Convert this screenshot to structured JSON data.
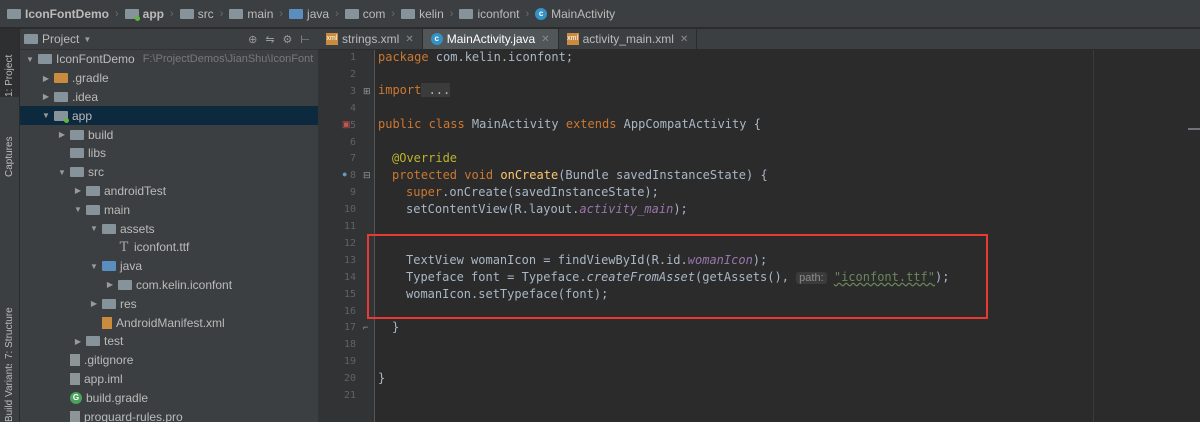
{
  "breadcrumb": [
    "IconFontDemo",
    "app",
    "src",
    "main",
    "java",
    "com",
    "kelin",
    "iconfont",
    "MainActivity"
  ],
  "left_tabs": {
    "project": "1: Project",
    "captures": "Captures",
    "structure": "7: Structure",
    "variants": "Build Variants"
  },
  "project_panel": {
    "title": "Project",
    "tree": [
      {
        "label": "IconFontDemo",
        "path": "F:\\ProjectDemos\\JianShu\\IconFont",
        "indent": 0,
        "arrow": "down",
        "icon": "folder"
      },
      {
        "label": ".gradle",
        "indent": 1,
        "arrow": "right",
        "icon": "folder-orange"
      },
      {
        "label": ".idea",
        "indent": 1,
        "arrow": "right",
        "icon": "folder"
      },
      {
        "label": "app",
        "indent": 1,
        "arrow": "down",
        "icon": "folder-app",
        "selected": true
      },
      {
        "label": "build",
        "indent": 2,
        "arrow": "right",
        "icon": "folder"
      },
      {
        "label": "libs",
        "indent": 2,
        "arrow": "",
        "icon": "folder"
      },
      {
        "label": "src",
        "indent": 2,
        "arrow": "down",
        "icon": "folder"
      },
      {
        "label": "androidTest",
        "indent": 3,
        "arrow": "right",
        "icon": "folder"
      },
      {
        "label": "main",
        "indent": 3,
        "arrow": "down",
        "icon": "folder"
      },
      {
        "label": "assets",
        "indent": 4,
        "arrow": "down",
        "icon": "folder"
      },
      {
        "label": "iconfont.ttf",
        "indent": 5,
        "arrow": "",
        "icon": "font-file"
      },
      {
        "label": "java",
        "indent": 4,
        "arrow": "down",
        "icon": "folder-blue"
      },
      {
        "label": "com.kelin.iconfont",
        "indent": 5,
        "arrow": "right",
        "icon": "folder"
      },
      {
        "label": "res",
        "indent": 4,
        "arrow": "right",
        "icon": "folder"
      },
      {
        "label": "AndroidManifest.xml",
        "indent": 4,
        "arrow": "",
        "icon": "xml-file"
      },
      {
        "label": "test",
        "indent": 3,
        "arrow": "right",
        "icon": "folder"
      },
      {
        "label": ".gitignore",
        "indent": 2,
        "arrow": "",
        "icon": "file"
      },
      {
        "label": "app.iml",
        "indent": 2,
        "arrow": "",
        "icon": "file"
      },
      {
        "label": "build.gradle",
        "indent": 2,
        "arrow": "",
        "icon": "gradle-file"
      },
      {
        "label": "proguard-rules.pro",
        "indent": 2,
        "arrow": "",
        "icon": "file"
      }
    ]
  },
  "tabs": [
    {
      "label": "strings.xml",
      "icon": "xml-file"
    },
    {
      "label": "MainActivity.java",
      "icon": "class",
      "active": true
    },
    {
      "label": "activity_main.xml",
      "icon": "xml-file"
    }
  ],
  "code": {
    "package_kw": "package",
    "package_name": " com.kelin.iconfont;",
    "import_kw": "import",
    "import_fold": " ...",
    "class_kw": "public class",
    "class_name": " MainActivity ",
    "extends_kw": "extends",
    "super_class": " AppCompatActivity {",
    "override": "@Override",
    "method_kw": "protected void",
    "method_name": " onCreate",
    "method_args": "(Bundle savedInstanceState) {",
    "super_kw": "super",
    "super_call": ".onCreate(savedInstanceState);",
    "set_content_a": "setContentView(R.layout.",
    "set_content_field": "activity_main",
    "set_content_b": ");",
    "line16_a": "TextView womanIcon = findViewById(R.id.",
    "line16_field": "womanIcon",
    "line16_b": ");",
    "line17_a": "Typeface font = Typeface.",
    "line17_method": "createFromAsset",
    "line17_b": "(getAssets(), ",
    "line17_hint": "path:",
    "line17_str": "\"iconfont.ttf\"",
    "line17_c": ");",
    "line18": "womanIcon.setTypeface(font);",
    "close_method": "}",
    "close_class": "}"
  }
}
